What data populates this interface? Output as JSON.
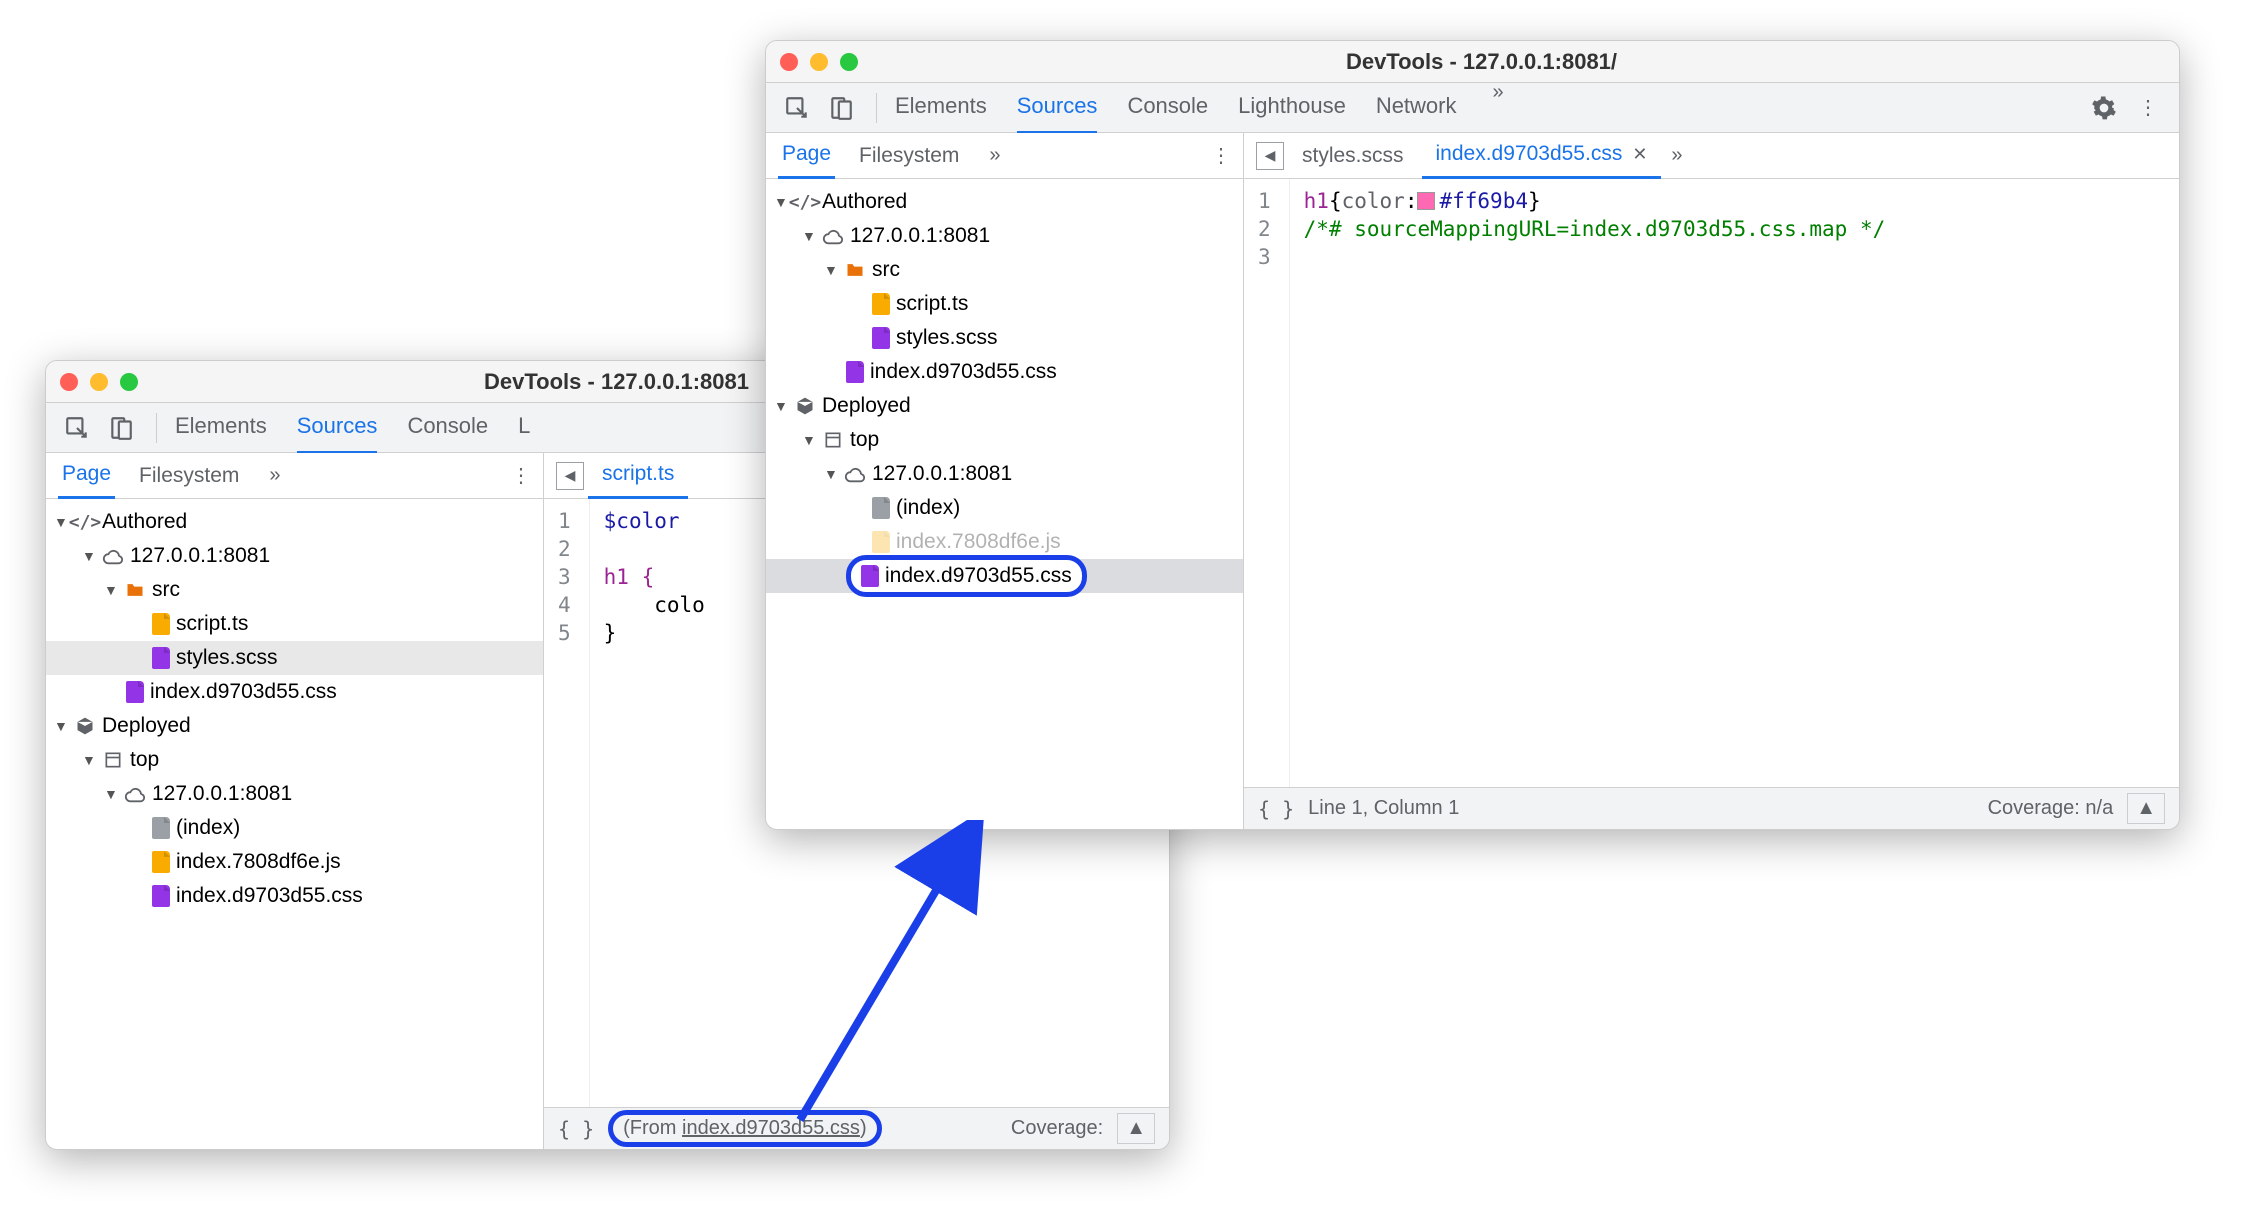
{
  "windowBack": {
    "title": "DevTools - 127.0.0.1:8081",
    "toolbar": {
      "t_elements": "Elements",
      "t_sources": "Sources",
      "t_console": "Console",
      "t_lighthouse_initial": "L"
    },
    "sidebar": {
      "t_page": "Page",
      "t_filesystem": "Filesystem",
      "tree": {
        "authored": "Authored",
        "host": "127.0.0.1:8081",
        "src": "src",
        "script_ts": "script.ts",
        "styles_scss": "styles.scss",
        "index_css": "index.d9703d55.css",
        "deployed": "Deployed",
        "top": "top",
        "host2": "127.0.0.1:8081",
        "index": "(index)",
        "index_js": "index.7808df6e.js",
        "index_css2": "index.d9703d55.css"
      }
    },
    "editor": {
      "tab_script": "script.ts",
      "lines": [
        "1",
        "2",
        "3",
        "4",
        "5"
      ],
      "code_l1": "$color",
      "code_l3": "h1 {",
      "code_l4": "    colo",
      "code_l5": "}"
    },
    "status": {
      "from_prefix": "(From ",
      "from_file": "index.d9703d55.css",
      "from_suffix": ")",
      "coverage": "Coverage:"
    }
  },
  "windowFront": {
    "title": "DevTools - 127.0.0.1:8081/",
    "toolbar": {
      "t_elements": "Elements",
      "t_sources": "Sources",
      "t_console": "Console",
      "t_lighthouse": "Lighthouse",
      "t_network": "Network"
    },
    "sidebar": {
      "t_page": "Page",
      "t_filesystem": "Filesystem",
      "tree": {
        "authored": "Authored",
        "host": "127.0.0.1:8081",
        "src": "src",
        "script_ts": "script.ts",
        "styles_scss": "styles.scss",
        "index_css": "index.d9703d55.css",
        "deployed": "Deployed",
        "top": "top",
        "host2": "127.0.0.1:8081",
        "index": "(index)",
        "index_js_partial": "index.7808df6e.js",
        "index_css2": "index.d9703d55.css"
      }
    },
    "editor": {
      "tab_styles": "styles.scss",
      "tab_index_css": "index.d9703d55.css",
      "lines": [
        "1",
        "2",
        "3"
      ],
      "code_sel": "h1",
      "code_brace_open": "{",
      "code_prop": "color",
      "code_colon": ":",
      "code_hex": "#ff69b4",
      "code_brace_close": "}",
      "code_comment": "/*# sourceMappingURL=index.d9703d55.css.map */"
    },
    "status": {
      "line_col": "Line 1, Column 1",
      "coverage": "Coverage: n/a"
    }
  }
}
